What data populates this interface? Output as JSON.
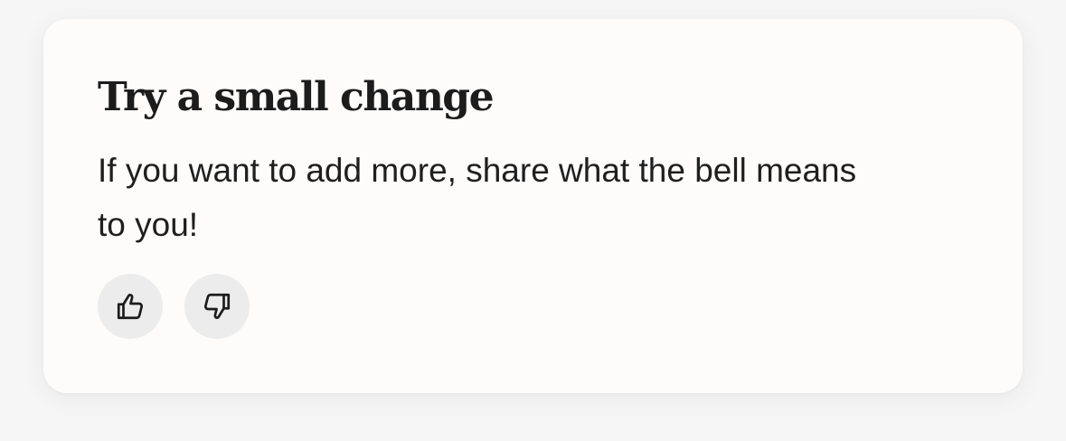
{
  "card": {
    "title": "Try a small change",
    "body": "If you want to add more, share what the bell means to you!"
  },
  "feedback": {
    "like_icon": "thumbs-up-icon",
    "dislike_icon": "thumbs-down-icon"
  }
}
